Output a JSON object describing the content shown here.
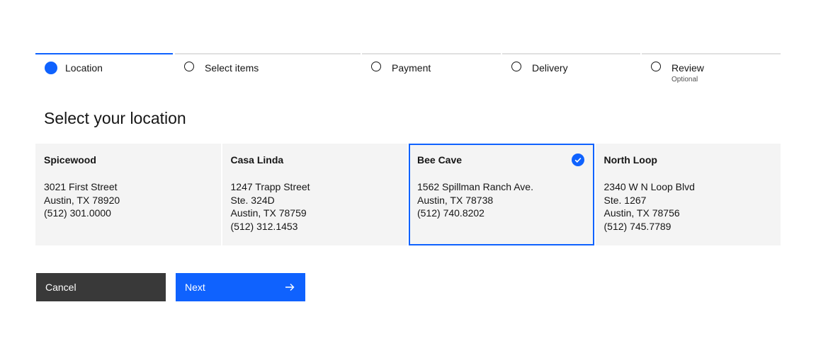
{
  "progress": {
    "steps": [
      {
        "label": "Location",
        "sub": "",
        "state": "current"
      },
      {
        "label": "Select items",
        "sub": "",
        "state": "incomplete"
      },
      {
        "label": "Payment",
        "sub": "",
        "state": "incomplete"
      },
      {
        "label": "Delivery",
        "sub": "",
        "state": "incomplete"
      },
      {
        "label": "Review",
        "sub": "Optional",
        "state": "incomplete"
      }
    ]
  },
  "heading": "Select your location",
  "tiles": [
    {
      "name": "Spicewood",
      "lines": [
        "3021 First Street",
        "Austin, TX 78920",
        "(512) 301.0000",
        ""
      ],
      "selected": false
    },
    {
      "name": "Casa Linda",
      "lines": [
        "1247 Trapp Street",
        "Ste. 324D",
        "Austin, TX 78759",
        "(512) 312.1453"
      ],
      "selected": false
    },
    {
      "name": "Bee Cave",
      "lines": [
        "1562 Spillman Ranch Ave.",
        "Austin, TX 78738",
        "(512) 740.8202",
        ""
      ],
      "selected": true
    },
    {
      "name": "North Loop",
      "lines": [
        "2340 W N Loop Blvd",
        "Ste. 1267",
        "Austin, TX 78756",
        "(512) 745.7789"
      ],
      "selected": false
    }
  ],
  "buttons": {
    "cancel": "Cancel",
    "next": "Next"
  },
  "colors": {
    "accent": "#0f62fe",
    "cancel_bg": "#393939",
    "tile_bg": "#f4f4f4"
  },
  "icons": {
    "selected_tile": "checkmark-filled-icon",
    "next_button": "arrow-right-icon"
  }
}
